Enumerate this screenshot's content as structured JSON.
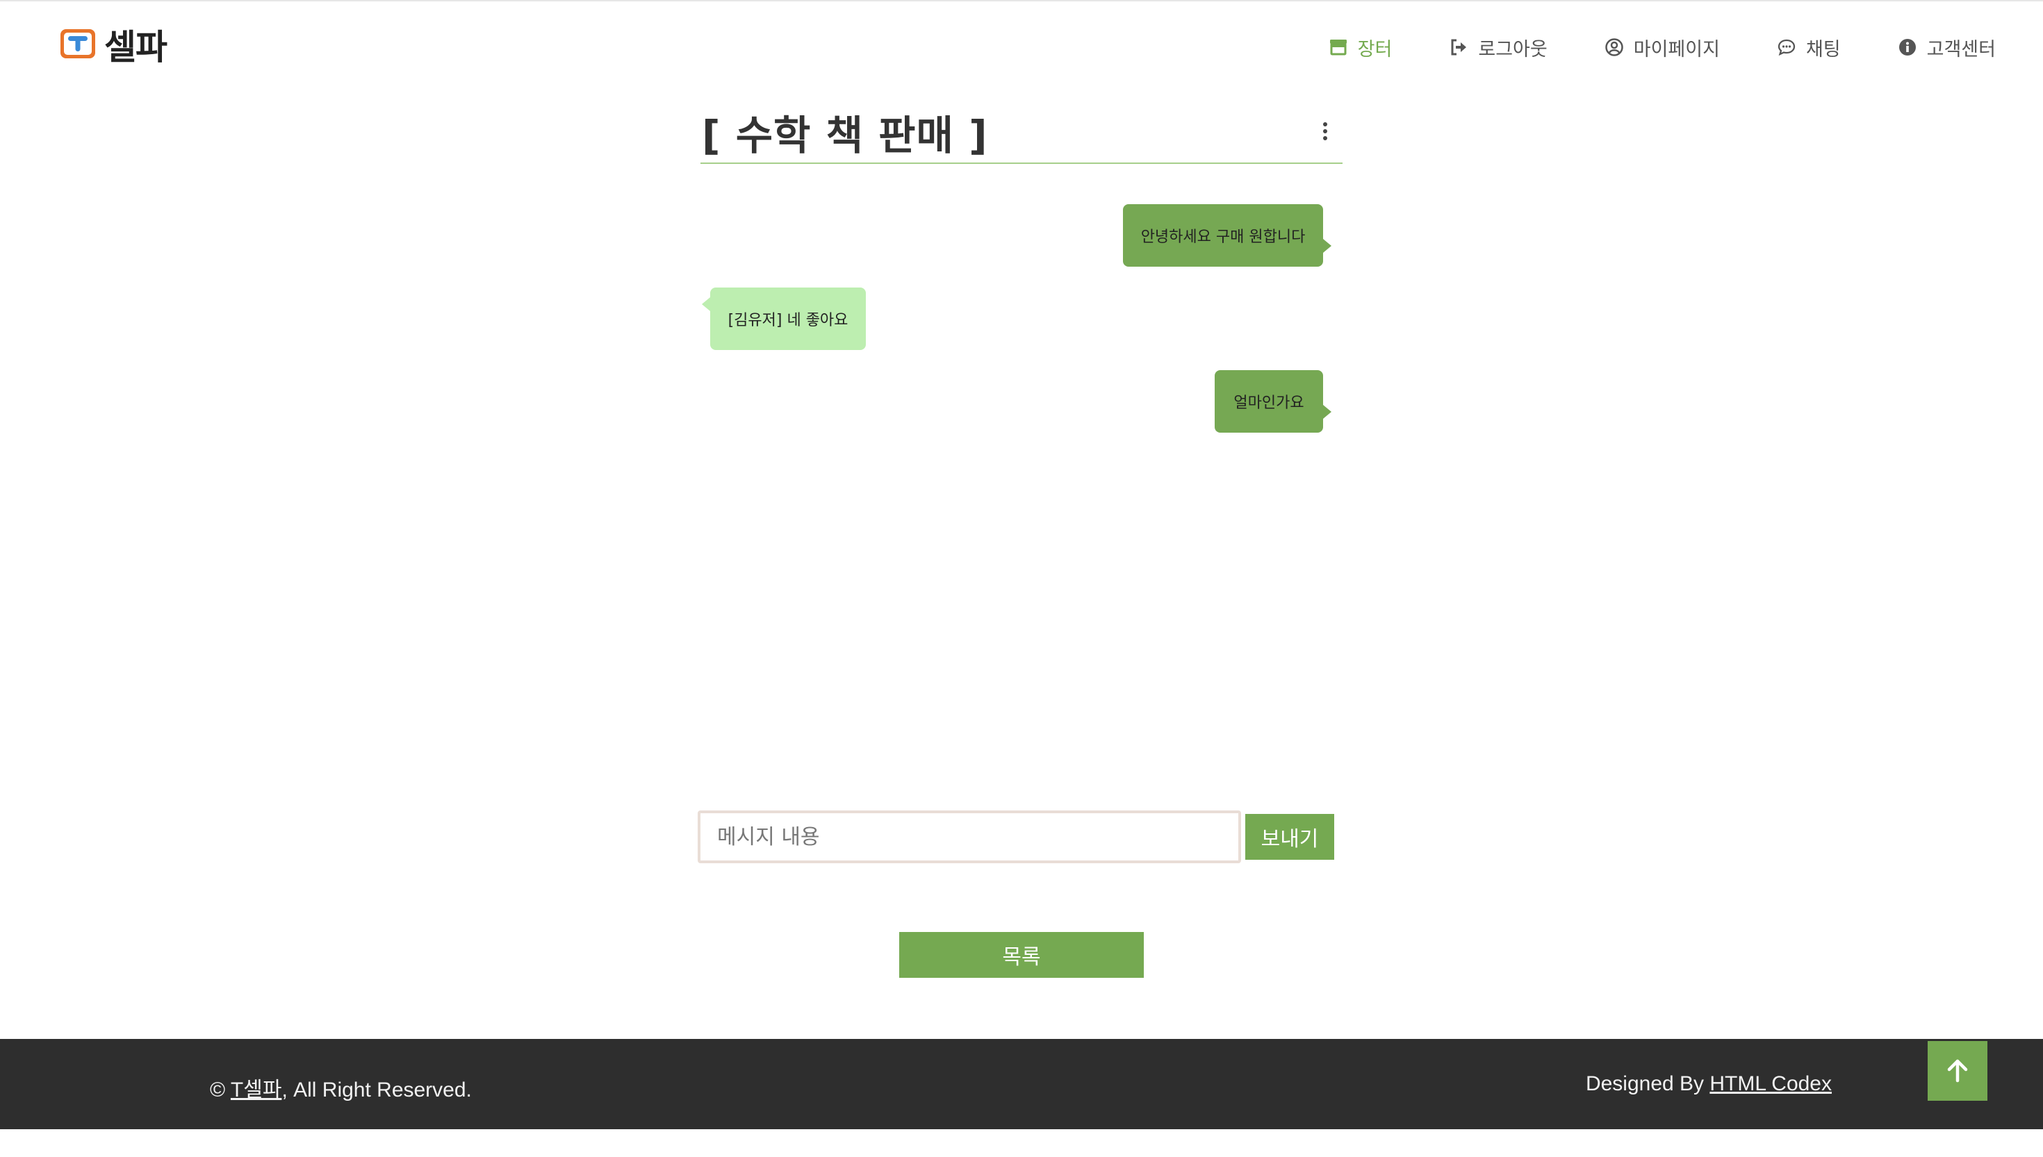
{
  "header": {
    "logo_text": "셀파",
    "nav": [
      {
        "label": "장터",
        "icon": "store-icon"
      },
      {
        "label": "로그아웃",
        "icon": "logout-icon"
      },
      {
        "label": "마이페이지",
        "icon": "user-circle-icon"
      },
      {
        "label": "채팅",
        "icon": "chat-icon"
      },
      {
        "label": "고객센터",
        "icon": "info-icon"
      }
    ]
  },
  "chat": {
    "title": "[ 수학 책 판매 ]",
    "messages": [
      {
        "side": "right",
        "text": "안녕하세요 구매 원합니다"
      },
      {
        "side": "left",
        "text": "[김유저] 네 좋아요"
      },
      {
        "side": "right",
        "text": "얼마인가요"
      }
    ],
    "input_placeholder": "메시지 내용",
    "send_label": "보내기",
    "list_label": "목록"
  },
  "footer": {
    "copyright_prefix": "© ",
    "copyright_link": "T셀파",
    "copyright_suffix": ", All Right Reserved.",
    "credit_prefix": "Designed By ",
    "credit_link": "HTML Codex"
  },
  "colors": {
    "accent": "#75a951",
    "bubble_right": "#76a853",
    "bubble_left": "#bdeeb0",
    "footer_bg": "#2e2e2e",
    "logo_orange": "#e8742a",
    "logo_blue": "#3a8ad8"
  }
}
